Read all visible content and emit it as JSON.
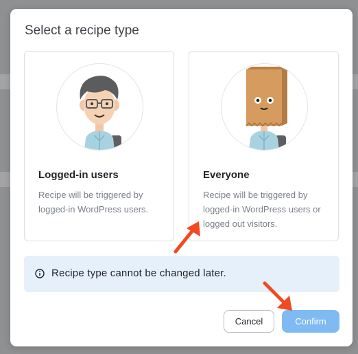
{
  "modal": {
    "title": "Select a recipe type",
    "options": [
      {
        "title": "Logged-in users",
        "description": "Recipe will be triggered by logged-in WordPress users.",
        "illustration": "person-with-hair-icon"
      },
      {
        "title": "Everyone",
        "description": "Recipe will be triggered by logged-in WordPress users or logged out visitors.",
        "illustration": "paper-bag-head-person-icon"
      }
    ],
    "notice": {
      "icon": "info-icon",
      "text": "Recipe type cannot be changed later."
    },
    "buttons": {
      "cancel_label": "Cancel",
      "confirm_label": "Confirm"
    }
  },
  "colors": {
    "backdrop": "#8f9092",
    "notice_background": "#e6f0fb",
    "confirm_button": "#7fbaf2",
    "annotation_arrow": "#f04a22"
  }
}
